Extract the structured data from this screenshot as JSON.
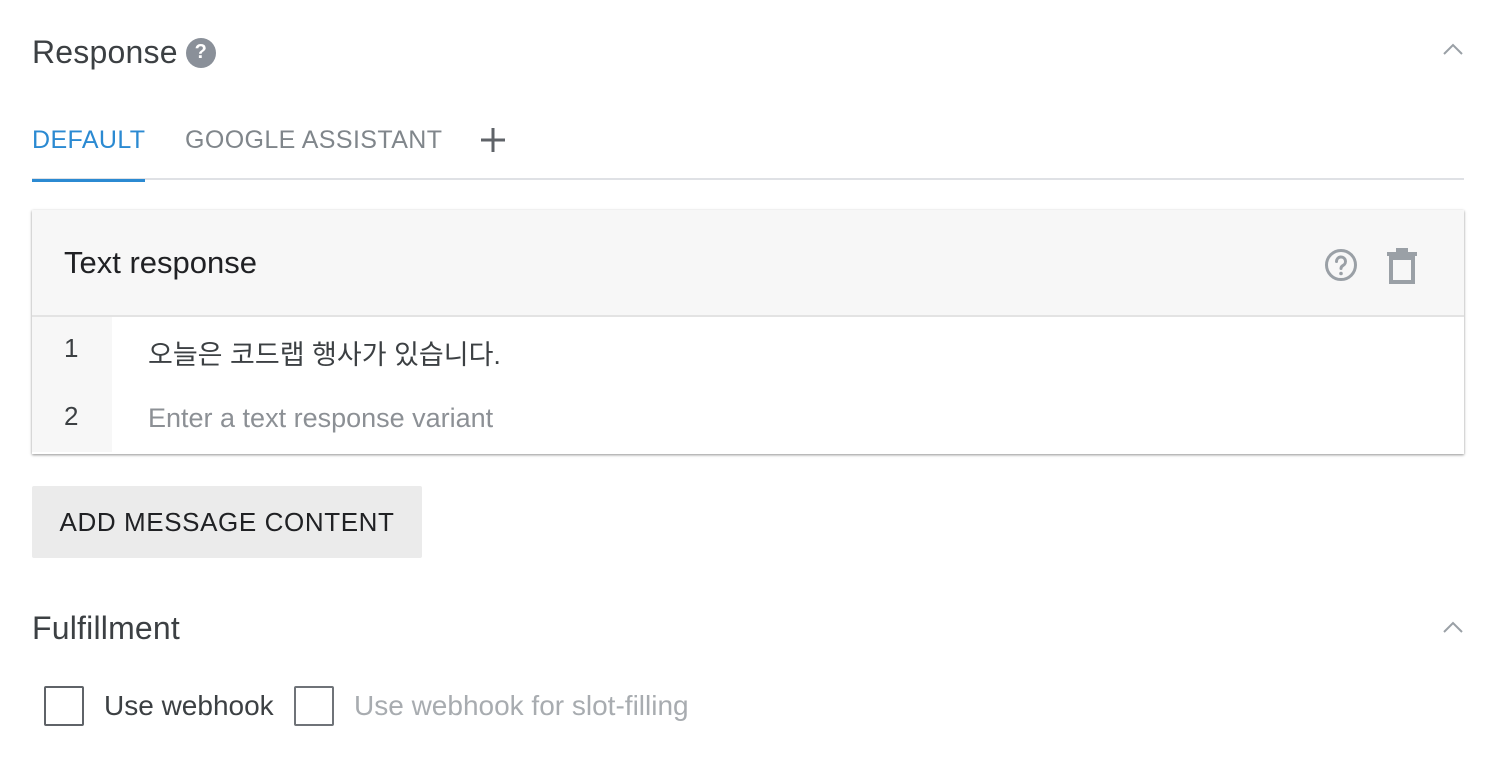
{
  "response_section": {
    "title": "Response",
    "help_icon_glyph": "?",
    "collapse_icon": "chevron-up-icon"
  },
  "tabs": [
    {
      "label": "DEFAULT",
      "active": true
    },
    {
      "label": "GOOGLE ASSISTANT",
      "active": false
    }
  ],
  "add_tab_icon": "plus-icon",
  "text_response_card": {
    "title": "Text response",
    "help_icon": "help-circle-icon",
    "delete_icon": "trash-icon",
    "rows": [
      {
        "number": "1",
        "text": "오늘은 코드랩 행사가 있습니다."
      },
      {
        "number": "2",
        "placeholder": "Enter a text response variant"
      }
    ]
  },
  "add_message_button": {
    "label": "ADD MESSAGE CONTENT"
  },
  "fulfillment_section": {
    "title": "Fulfillment",
    "collapse_icon": "chevron-up-icon",
    "checkboxes": [
      {
        "label": "Use webhook",
        "checked": false,
        "enabled": true
      },
      {
        "label": "Use webhook for slot-filling",
        "checked": false,
        "enabled": false
      }
    ]
  },
  "colors": {
    "accent": "#2b8ad2",
    "muted_text": "#80868b",
    "disabled_text": "#a8acb0",
    "icon_gray": "#9aa0a6"
  }
}
